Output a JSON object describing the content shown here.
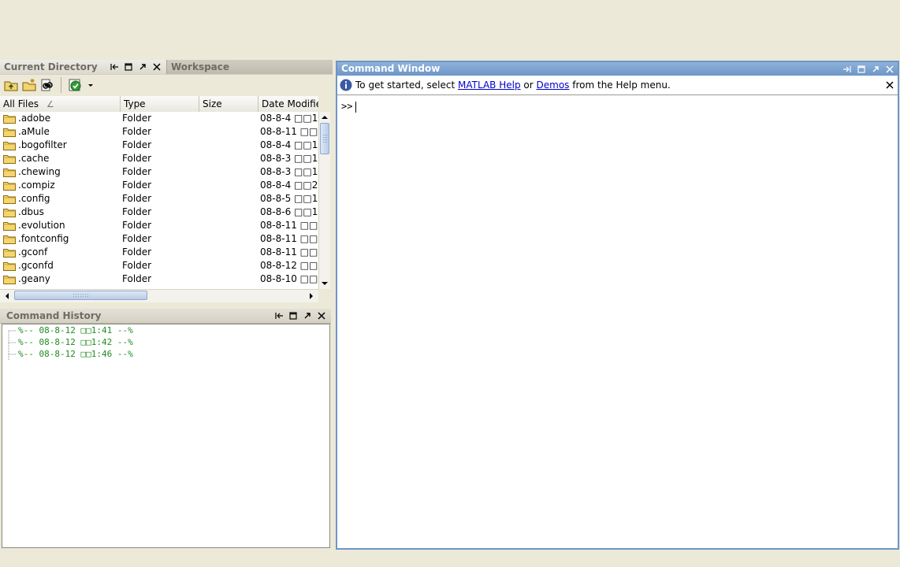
{
  "current_directory": {
    "tab_title": "Current Directory",
    "workspace_tab": "Workspace",
    "toolbar": {
      "up_icon": "folder-up-icon",
      "new_folder_icon": "new-folder-icon",
      "find_files_icon": "find-files-icon",
      "actions_icon": "check-actions-icon"
    },
    "columns": [
      "All Files",
      "Type",
      "Size",
      "Date Modifie"
    ],
    "sort_indicator": "∠",
    "rows": [
      {
        "name": ".adobe",
        "type": "Folder",
        "size": "",
        "date": "08-8-4 □□1"
      },
      {
        "name": ".aMule",
        "type": "Folder",
        "size": "",
        "date": "08-8-11 □□"
      },
      {
        "name": ".bogofilter",
        "type": "Folder",
        "size": "",
        "date": "08-8-4 □□1"
      },
      {
        "name": ".cache",
        "type": "Folder",
        "size": "",
        "date": "08-8-3 □□1"
      },
      {
        "name": ".chewing",
        "type": "Folder",
        "size": "",
        "date": "08-8-3 □□1"
      },
      {
        "name": ".compiz",
        "type": "Folder",
        "size": "",
        "date": "08-8-4 □□2"
      },
      {
        "name": ".config",
        "type": "Folder",
        "size": "",
        "date": "08-8-5 □□1"
      },
      {
        "name": ".dbus",
        "type": "Folder",
        "size": "",
        "date": "08-8-6 □□1"
      },
      {
        "name": ".evolution",
        "type": "Folder",
        "size": "",
        "date": "08-8-11 □□"
      },
      {
        "name": ".fontconfig",
        "type": "Folder",
        "size": "",
        "date": "08-8-11 □□"
      },
      {
        "name": ".gconf",
        "type": "Folder",
        "size": "",
        "date": "08-8-11 □□"
      },
      {
        "name": ".gconfd",
        "type": "Folder",
        "size": "",
        "date": "08-8-12 □□"
      },
      {
        "name": ".geany",
        "type": "Folder",
        "size": "",
        "date": "08-8-10 □□"
      }
    ]
  },
  "command_history": {
    "title": "Command History",
    "entries": [
      "%-- 08-8-12 □□1:41 --%",
      "%-- 08-8-12 □□1:42 --%",
      "%-- 08-8-12 □□1:46 --%"
    ]
  },
  "command_window": {
    "title": "Command Window",
    "info": {
      "prefix": "To get started, select",
      "link1": "MATLAB Help",
      "middle": "or",
      "link2": "Demos",
      "suffix": "from the Help menu."
    },
    "prompt": ">>"
  },
  "colors": {
    "background": "#ece9d8",
    "active_title": "#6d96c8",
    "history_text": "#228b22",
    "link": "#0000cc"
  }
}
